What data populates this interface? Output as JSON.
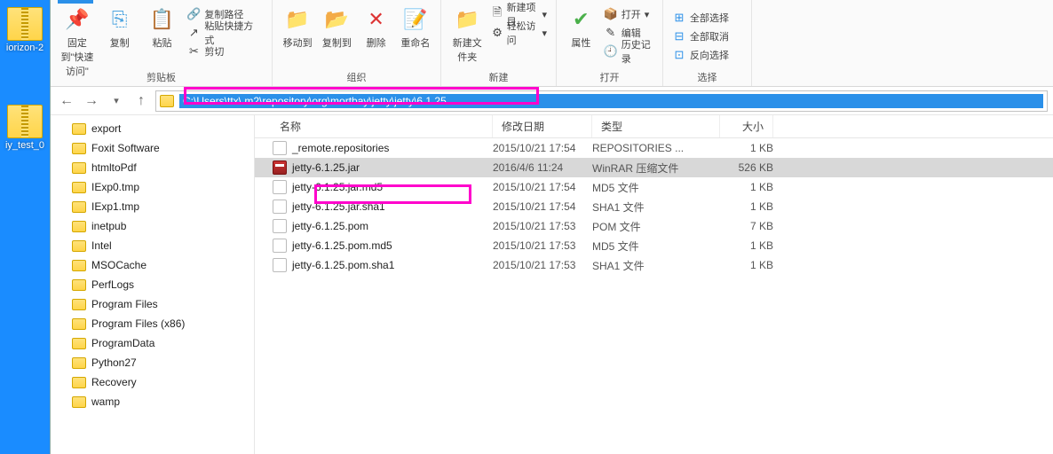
{
  "desktop": {
    "icons": [
      {
        "label": "iorizon-2"
      },
      {
        "label": "iy_test_0"
      }
    ]
  },
  "ribbon": {
    "pin_quick": "固定到\"快速访问\"",
    "copy": "复制",
    "paste": "粘贴",
    "copy_path": "复制路径",
    "paste_shortcut": "粘贴快捷方式",
    "cut": "剪切",
    "group_clipboard": "剪贴板",
    "move_to": "移动到",
    "copy_to": "复制到",
    "delete": "删除",
    "rename": "重命名",
    "group_organize": "组织",
    "new_folder": "新建文件夹",
    "new_item": "新建项目",
    "easy_access": "轻松访问",
    "group_new": "新建",
    "properties": "属性",
    "open": "打开",
    "edit": "编辑",
    "history": "历史记录",
    "group_open": "打开",
    "select_all": "全部选择",
    "select_none": "全部取消",
    "invert_selection": "反向选择",
    "group_select": "选择"
  },
  "address": {
    "path": "C:\\Users\\ttx\\.m2\\repository\\org\\mortbay\\jetty\\jetty\\6.1.25"
  },
  "tree": {
    "items": [
      "export",
      "Foxit Software",
      "htmltoPdf",
      "IExp0.tmp",
      "IExp1.tmp",
      "inetpub",
      "Intel",
      "MSOCache",
      "PerfLogs",
      "Program Files",
      "Program Files (x86)",
      "ProgramData",
      "Python27",
      "Recovery",
      "wamp"
    ]
  },
  "columns": {
    "name": "名称",
    "date": "修改日期",
    "type": "类型",
    "size": "大小"
  },
  "files": [
    {
      "name": "_remote.repositories",
      "date": "2015/10/21 17:54",
      "type": "REPOSITORIES ...",
      "size": "1 KB",
      "icon": "doc"
    },
    {
      "name": "jetty-6.1.25.jar",
      "date": "2016/4/6 11:24",
      "type": "WinRAR 压缩文件",
      "size": "526 KB",
      "icon": "rar",
      "selected": true
    },
    {
      "name": "jetty-6.1.25.jar.md5",
      "date": "2015/10/21 17:54",
      "type": "MD5 文件",
      "size": "1 KB",
      "icon": "doc"
    },
    {
      "name": "jetty-6.1.25.jar.sha1",
      "date": "2015/10/21 17:54",
      "type": "SHA1 文件",
      "size": "1 KB",
      "icon": "doc"
    },
    {
      "name": "jetty-6.1.25.pom",
      "date": "2015/10/21 17:53",
      "type": "POM 文件",
      "size": "7 KB",
      "icon": "doc"
    },
    {
      "name": "jetty-6.1.25.pom.md5",
      "date": "2015/10/21 17:53",
      "type": "MD5 文件",
      "size": "1 KB",
      "icon": "doc"
    },
    {
      "name": "jetty-6.1.25.pom.sha1",
      "date": "2015/10/21 17:53",
      "type": "SHA1 文件",
      "size": "1 KB",
      "icon": "doc"
    }
  ]
}
